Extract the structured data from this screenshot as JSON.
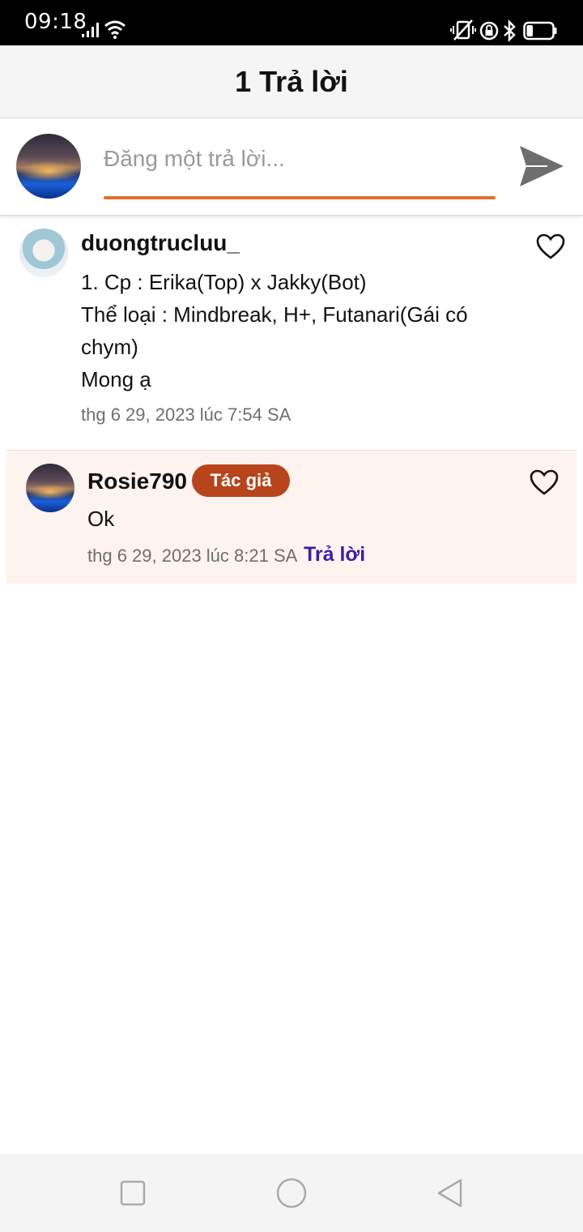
{
  "status_bar": {
    "time": "09:18",
    "icons": [
      "signal-icon",
      "wifi-icon",
      "vibrate-icon",
      "rotation-lock-icon",
      "bluetooth-icon",
      "battery-icon"
    ],
    "battery_level": 0.25
  },
  "header": {
    "title": "1 Trả lời"
  },
  "composer": {
    "placeholder": "Đăng một trả lời...",
    "value": "",
    "send_icon": "send-icon",
    "accent_color": "#e0702e"
  },
  "comments": [
    {
      "username": "duongtrucluu_",
      "lines": [
        "1. Cp : Erika(Top) x Jakky(Bot)",
        "Thể loại : Mindbreak, H+, Futanari(Gái có",
        "chym)",
        "Mong ạ"
      ],
      "timestamp": "thg 6 29, 2023 lúc 7:54 SA",
      "like_icon": "heart-outline-icon"
    },
    {
      "username": "Rosie790",
      "badge": "Tác giả",
      "text": "Ok",
      "timestamp": "thg 6 29, 2023 lúc 8:21 SA",
      "reply_label": "Trả lời",
      "like_icon": "heart-outline-icon",
      "badge_color": "#b8441c",
      "reply_color": "#3a1fa6",
      "background": "#fdf3ef"
    }
  ],
  "nav_bar": {
    "buttons": [
      "recents-square-icon",
      "home-circle-icon",
      "back-triangle-icon"
    ]
  }
}
